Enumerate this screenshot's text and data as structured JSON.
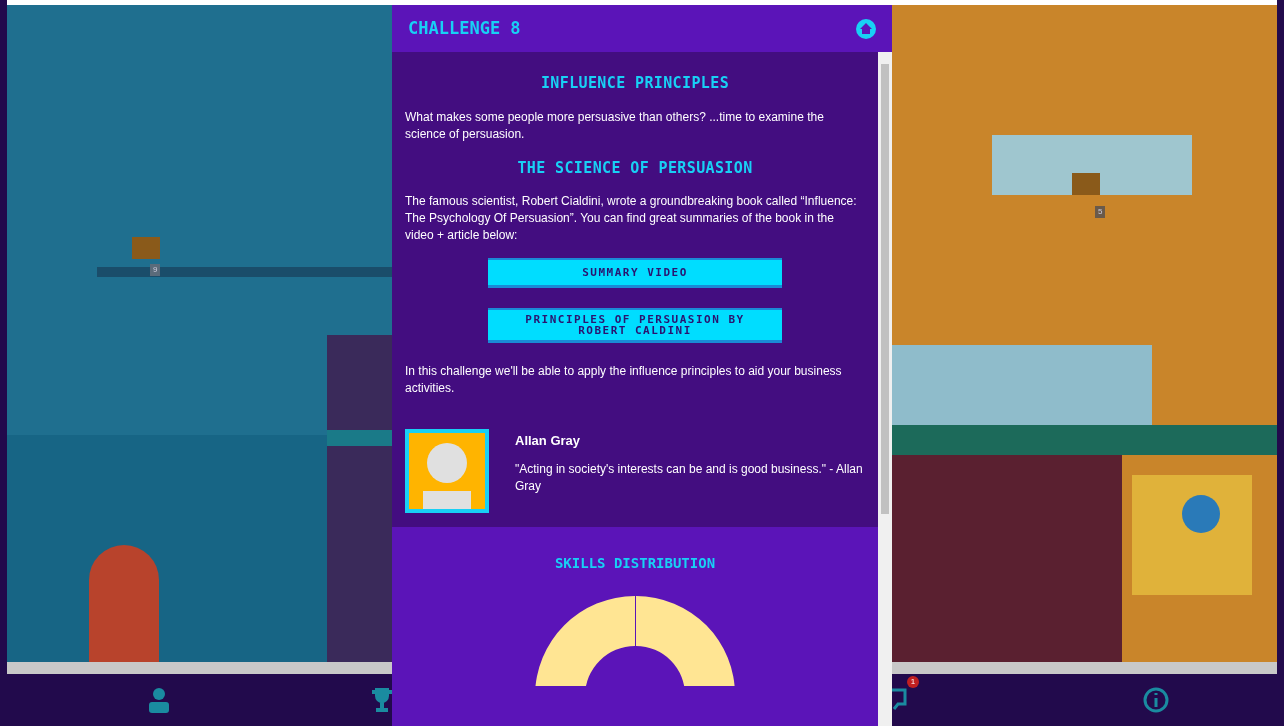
{
  "modal": {
    "title": "CHALLENGE 8",
    "blocks": [
      {
        "kind": "heading",
        "text": "INFLUENCE PRINCIPLES"
      },
      {
        "kind": "paragraph",
        "text": "What makes some people more persuasive than others? ...time to examine the science of persuasion."
      },
      {
        "kind": "heading",
        "text": "THE SCIENCE OF PERSUASION"
      },
      {
        "kind": "paragraph",
        "text": "The famous scientist, Robert Cialdini, wrote a groundbreaking book called “Influence: The Psychology Of Persuasion”. You can find great summaries of the book in the video + article below:"
      },
      {
        "kind": "button",
        "text": "SUMMARY VIDEO"
      },
      {
        "kind": "button",
        "text": "PRINCIPLES OF PERSUASION BY ROBERT CALDINI"
      },
      {
        "kind": "paragraph",
        "text": "In this challenge we'll be able to apply the influence principles to aid your business activities."
      }
    ],
    "mentor": {
      "name": "Allan Gray",
      "quote": "\"Acting in society's interests can be and is good business.\" - Allan Gray"
    },
    "skills": {
      "title": "SKILLS DISTRIBUTION"
    }
  },
  "map_labels": [
    "9",
    "5"
  ],
  "bottom_nav": {
    "messages_badge": "1"
  }
}
